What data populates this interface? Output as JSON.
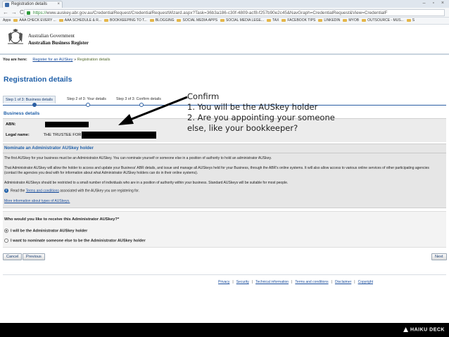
{
  "browser": {
    "tab_title": "Registration details",
    "tab_close": "×",
    "url_prefix": "https://",
    "url_domain": "www.auskey.abr.gov.au",
    "url_path": "/CredentialRequest/CredentialRequestWizard.aspx?Task=36b3a186-c30f-4809-acf8-f257b90e2c45&NavGraph=CredentialRequest&View=CredentialF",
    "window_controls": "– ▫ ×",
    "bookmarks": [
      "Apps",
      "AAA CHECK EVERY ...",
      "AAA SCHEDULE & R...",
      "BOOKKEEPING TO T...",
      "BLOGGING",
      "SOCIAL MEDIA APPS",
      "SOCIAL MEDIA LEGE...",
      "TAX",
      "FACEBOOK TIPS",
      "LINKEDIN",
      "MYOB",
      "OUTSOURCE - MUS...",
      "S"
    ]
  },
  "header": {
    "line1": "Australian Government",
    "line2": "Australian Business Register"
  },
  "breadcrumb": {
    "prefix": "You are here:",
    "link": "Register for an AUSkey",
    "separator": "»",
    "current": "Registration details"
  },
  "page_title": "Registration details",
  "steps": [
    {
      "label": "Step 1 of 3: Business details"
    },
    {
      "label": "Step 2 of 3: Your details"
    },
    {
      "label": "Step 3 of 3: Confirm details"
    }
  ],
  "business_details": {
    "heading": "Business details",
    "abn_label": "ABN:",
    "legal_name_label": "Legal name:",
    "legal_name_value": "THE TRUSTEE FOR T"
  },
  "nominate": {
    "heading": "Nominate an Administrator AUSkey holder",
    "p1": "The first AUSkey for your business must be an Administrator AUSkey. You can nominate yourself or someone else in a position of authority to hold an administrator AUSkey.",
    "p2": "That Administrator AUSkey will allow the holder to access and update your Business' ABR details, and issue and manage all AUSkeys held for your Business, through the ABR's online systems. It will also allow access to various online services of other participating agencies (contact the agencies you deal with for information about what Administrator AUSkey holders can do in their online systems).",
    "p3": "Administrator AUSkeys should be restricted to a small number of individuals who are in a position of authority within your business. Standard AUSkeys will be suitable for most people.",
    "p4_before": "Read the",
    "p4_link": "Terms and conditions",
    "p4_after": "associated with the AUSkey you are registering for.",
    "more_link": "More information about types of AUSkeys."
  },
  "question": {
    "text": "Who would you like to receive this Administrator AUSkey?*",
    "option1": "I will be the Administrator AUSkey holder",
    "option2": "I want to nominate someone else to be the Administrator AUSkey holder",
    "selected": 1
  },
  "buttons": {
    "cancel": "Cancel",
    "previous": "Previous",
    "next": "Next"
  },
  "footer_links": [
    "Privacy",
    "Security",
    "Technical information",
    "Terms and conditions",
    "Disclaimer",
    "Copyright"
  ],
  "annotation": {
    "line1": "Confirm",
    "line2": "1. You will be the AUSkey holder",
    "line3": "2. Are you appointing your someone",
    "line4": "else, like your bookkeeper?"
  },
  "branding": "HAIKU DECK",
  "colors": {
    "accent": "#1f5fa8",
    "link": "#1a4d9c"
  }
}
